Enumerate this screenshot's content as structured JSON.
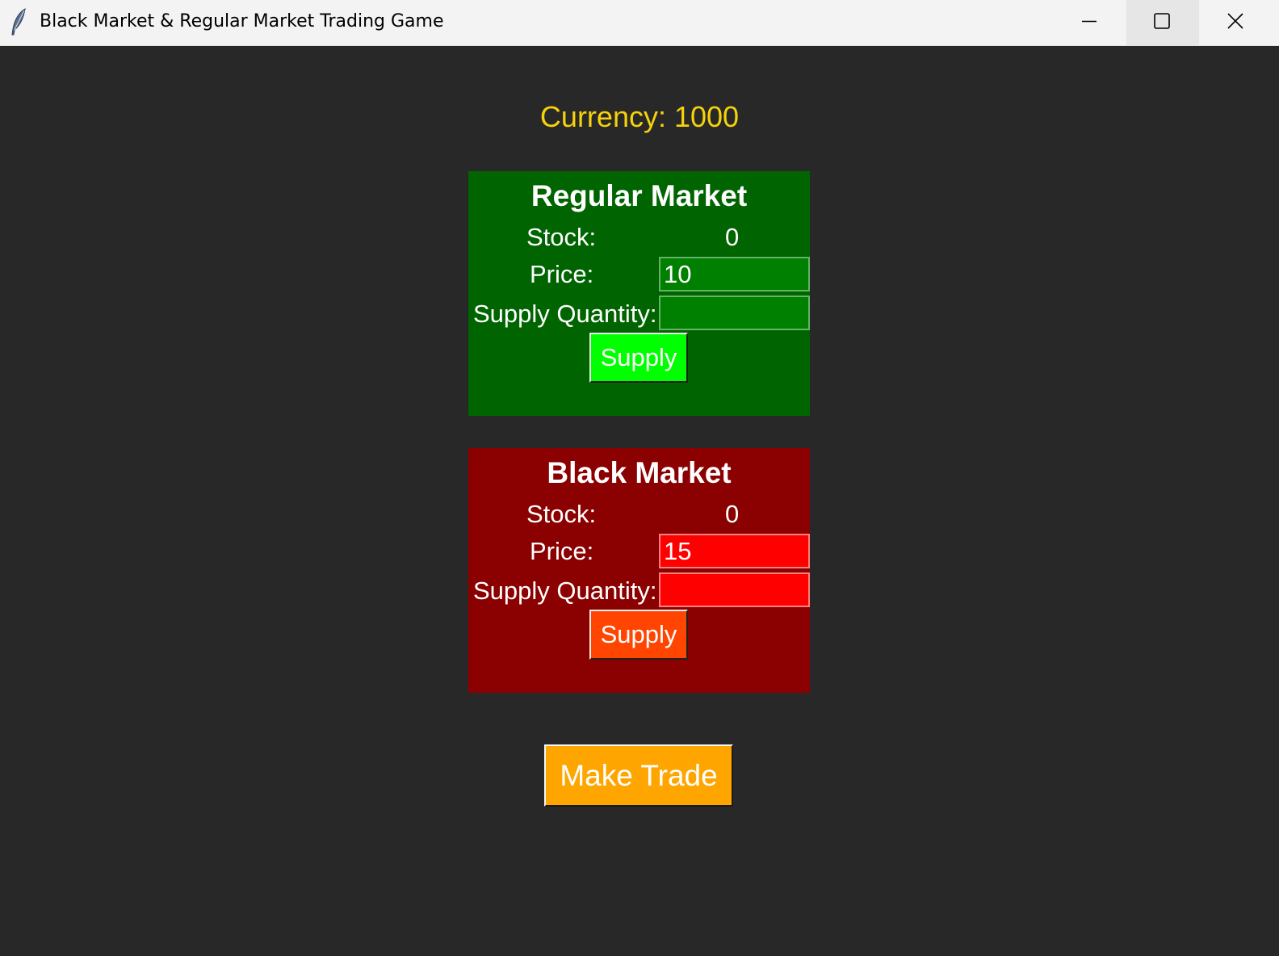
{
  "window": {
    "title": "Black Market & Regular Market Trading Game",
    "app_icon": "feather-icon",
    "controls": [
      "minimize-icon",
      "maximize-icon",
      "close-icon"
    ]
  },
  "currency": {
    "label": "Currency: 1000",
    "color": "#f5d20a"
  },
  "regular_market": {
    "title": "Regular Market",
    "stock_label": "Stock:",
    "stock_value": "0",
    "price_label": "Price:",
    "price_value": "10",
    "supply_quantity_label": "Supply Quantity:",
    "supply_quantity_value": "",
    "supply_button": "Supply",
    "colors": {
      "panel": "#006400",
      "field": "#008000",
      "button": "#00ff00"
    }
  },
  "black_market": {
    "title": "Black Market",
    "stock_label": "Stock:",
    "stock_value": "0",
    "price_label": "Price:",
    "price_value": "15",
    "supply_quantity_label": "Supply Quantity:",
    "supply_quantity_value": "",
    "supply_button": "Supply",
    "colors": {
      "panel": "#8b0000",
      "field": "#ff0000",
      "button": "#ff4500"
    }
  },
  "trade_button": {
    "label": "Make Trade",
    "color": "#ffa500"
  }
}
